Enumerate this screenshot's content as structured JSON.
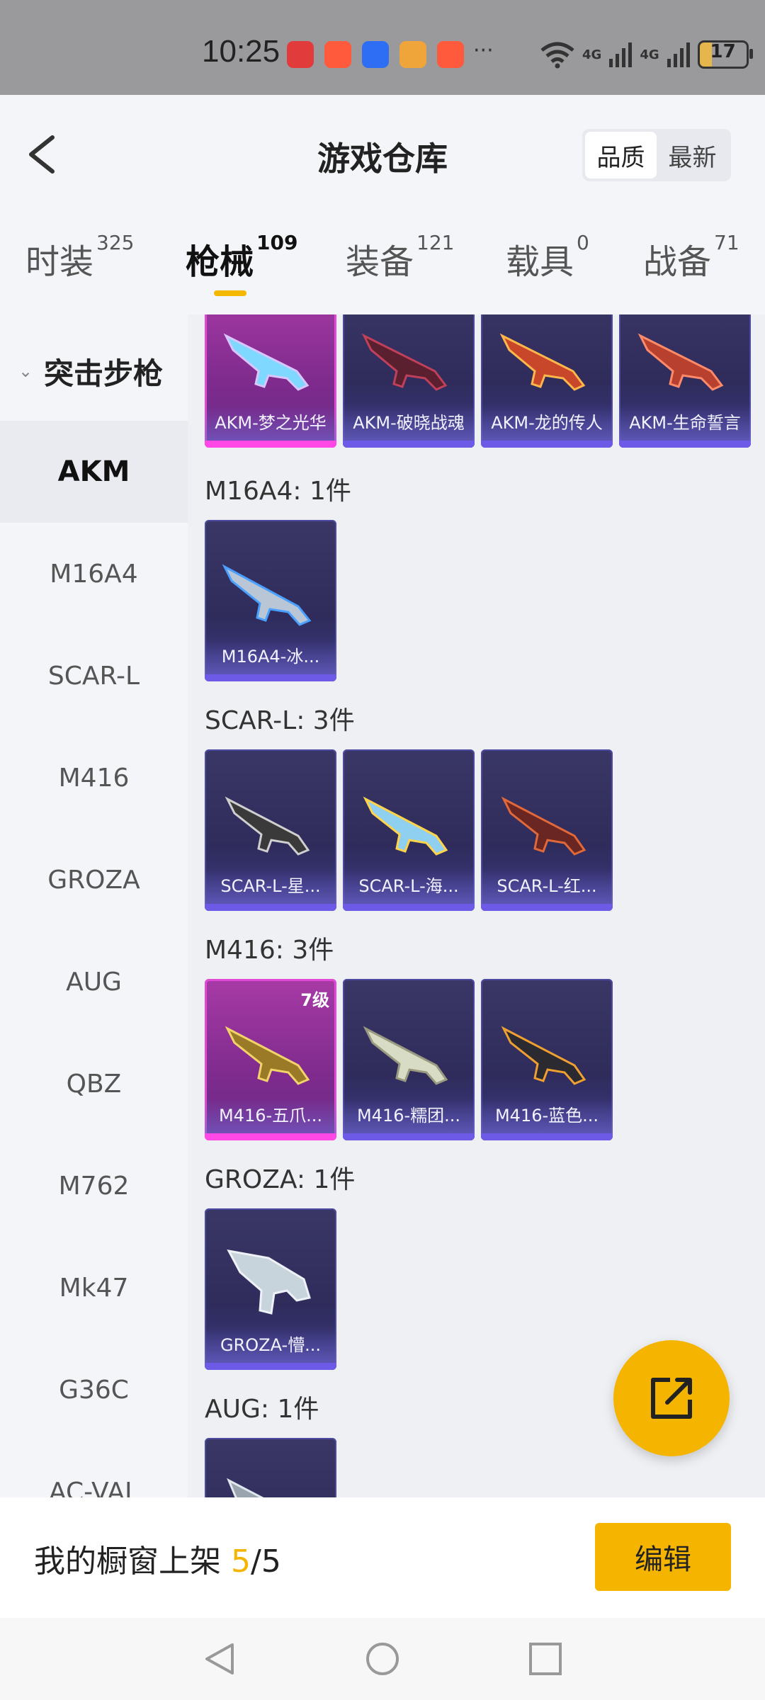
{
  "status_bar": {
    "time": "10:25",
    "dots": "···",
    "signal_1": "4G",
    "signal_2": "4G",
    "battery": "17"
  },
  "header": {
    "title": "游戏仓库",
    "sort": [
      "品质",
      "最新"
    ]
  },
  "tabs": [
    {
      "label": "时装",
      "count": "325"
    },
    {
      "label": "枪械",
      "count": "109"
    },
    {
      "label": "装备",
      "count": "121"
    },
    {
      "label": "载具",
      "count": "0"
    },
    {
      "label": "战备",
      "count": "71"
    }
  ],
  "sidebar": {
    "category": "突击步枪",
    "items": [
      "AKM",
      "M16A4",
      "SCAR-L",
      "M416",
      "GROZA",
      "AUG",
      "QBZ",
      "M762",
      "Mk47",
      "G36C",
      "AC-VAL"
    ]
  },
  "groups": [
    {
      "label": "",
      "items": [
        {
          "name": "AKM-梦之光华",
          "rarity": "pink"
        },
        {
          "name": "AKM-破晓战魂",
          "rarity": "purple"
        },
        {
          "name": "AKM-龙的传人",
          "rarity": "purple"
        },
        {
          "name": "AKM-生命誓言",
          "rarity": "purple"
        }
      ]
    },
    {
      "label": "M16A4: 1件",
      "items": [
        {
          "name": "M16A4-冰...",
          "rarity": "purple"
        }
      ]
    },
    {
      "label": "SCAR-L: 3件",
      "items": [
        {
          "name": "SCAR-L-星...",
          "rarity": "purple"
        },
        {
          "name": "SCAR-L-海...",
          "rarity": "purple"
        },
        {
          "name": "SCAR-L-红...",
          "rarity": "purple"
        }
      ]
    },
    {
      "label": "M416: 3件",
      "items": [
        {
          "name": "M416-五爪...",
          "rarity": "pink",
          "badge": "7级"
        },
        {
          "name": "M416-糯团...",
          "rarity": "purple"
        },
        {
          "name": "M416-蓝色...",
          "rarity": "purple"
        }
      ]
    },
    {
      "label": "GROZA: 1件",
      "items": [
        {
          "name": "GROZA-懵...",
          "rarity": "purple"
        }
      ]
    },
    {
      "label": "AUG: 1件",
      "items": [
        {
          "name": "",
          "rarity": "purple"
        }
      ]
    }
  ],
  "footer": {
    "shelf_label": "我的橱窗上架",
    "shelf_current": "5",
    "shelf_total": "/5",
    "edit_label": "编辑"
  },
  "colors": {
    "accent": "#f5b400",
    "pink_rarity": "#e04ad6",
    "purple_rarity": "#6d5be8"
  }
}
